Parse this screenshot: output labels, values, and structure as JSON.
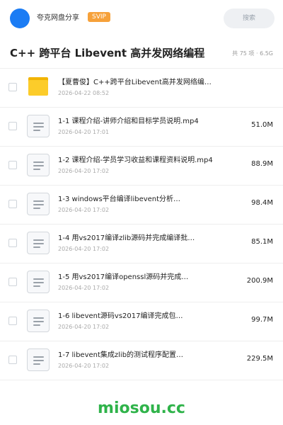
{
  "header": {
    "share_name": "夸克网盘分享",
    "badge": "SVIP",
    "search_label": "搜索",
    "avatar_color": "#1b7cf4",
    "badge_color": "#f6a13a"
  },
  "title": {
    "text": "C++ 跨平台 Libevent 高并发网络编程",
    "meta": "共 75 项 · 6.5G"
  },
  "files": [
    {
      "type": "folder",
      "name": "【夏曹俊】C++跨平台Libevent高并发网络编…",
      "date": "2026-04-22 08:52",
      "size": ""
    },
    {
      "type": "file",
      "name": "1-1 课程介绍-讲师介绍和目标学员说明.mp4",
      "date": "2026-04-20 17:01",
      "size": "51.0M"
    },
    {
      "type": "file",
      "name": "1-2 课程介绍-学员学习收益和课程资料说明.mp4",
      "date": "2026-04-20 17:02",
      "size": "88.9M"
    },
    {
      "type": "file",
      "name": "1-3 windows平台编译libevent分析…",
      "date": "2026-04-20 17:02",
      "size": "98.4M"
    },
    {
      "type": "file",
      "name": "1-4 用vs2017编译zlib源码并完成编译批…",
      "date": "2026-04-20 17:02",
      "size": "85.1M"
    },
    {
      "type": "file",
      "name": "1-5 用vs2017编译openssl源码并完成…",
      "date": "2026-04-20 17:02",
      "size": "200.9M"
    },
    {
      "type": "file",
      "name": "1-6 libevent源码vs2017编译完成包…",
      "date": "2026-04-20 17:02",
      "size": "99.7M"
    },
    {
      "type": "file",
      "name": "1-7 libevent集成zlib的测试程序配置…",
      "date": "2026-04-20 17:02",
      "size": "229.5M"
    }
  ],
  "watermark": "miosou.cc"
}
